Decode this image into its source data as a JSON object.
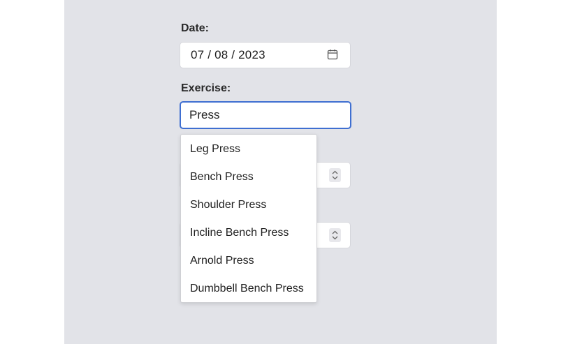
{
  "form": {
    "date_label": "Date:",
    "date_value": "07 / 08 / 2023",
    "exercise_label": "Exercise:",
    "exercise_value": "Press"
  },
  "autocomplete": {
    "options": [
      "Leg Press",
      "Bench Press",
      "Shoulder Press",
      "Incline Bench Press",
      "Arnold Press",
      "Dumbbell Bench Press"
    ]
  },
  "icons": {
    "date": "calendar-icon",
    "stepper": "stepper-arrows-icon"
  },
  "colors": {
    "background_panel": "#e2e3e8",
    "focus_border": "#3f6fd1"
  }
}
